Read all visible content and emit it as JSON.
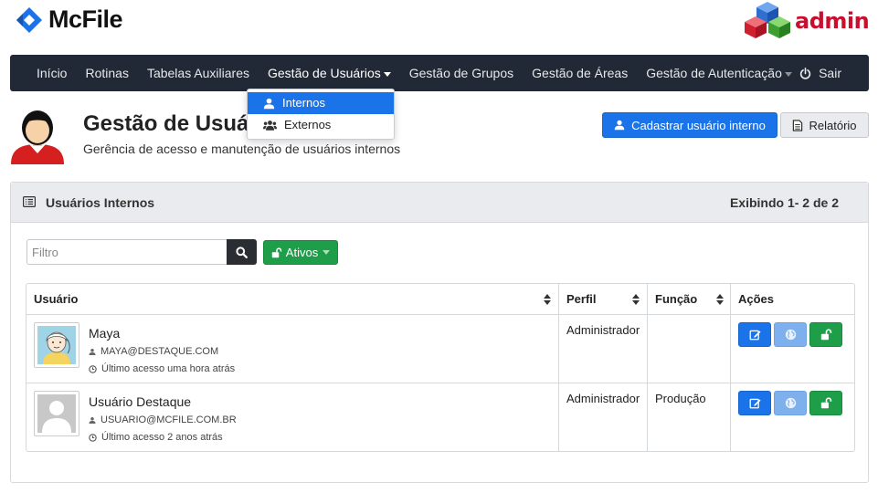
{
  "brand": {
    "name": "McFile",
    "admin_label": "admin"
  },
  "nav": {
    "items": [
      {
        "label": "Início"
      },
      {
        "label": "Rotinas"
      },
      {
        "label": "Tabelas Auxiliares"
      },
      {
        "label": "Gestão de Usuários"
      },
      {
        "label": "Gestão de Grupos"
      },
      {
        "label": "Gestão de Áreas"
      },
      {
        "label": "Gestão de Autenticação"
      }
    ],
    "logout": "Sair"
  },
  "dropdown": {
    "items": [
      {
        "label": "Internos"
      },
      {
        "label": "Externos"
      }
    ]
  },
  "page": {
    "title": "Gestão de Usuá",
    "subtitle": "Gerência de acesso e manutenção de usuários internos",
    "add_button": "Cadastrar usuário interno",
    "report_button": "Relatório"
  },
  "panel": {
    "title": "Usuários Internos",
    "count": "Exibindo 1- 2 de 2",
    "filter_placeholder": "Filtro",
    "status_label": "Ativos"
  },
  "table": {
    "columns": [
      "Usuário",
      "Perfil",
      "Função",
      "Ações"
    ],
    "rows": [
      {
        "name": "Maya",
        "email": "MAYA@DESTAQUE.COM",
        "last_access": "Último acesso uma hora atrás",
        "profile": "Administrador",
        "function": ""
      },
      {
        "name": "Usuário Destaque",
        "email": "USUARIO@MCFILE.COM.BR",
        "last_access": "Último acesso 2 anos atrás",
        "profile": "Administrador",
        "function": "Produção"
      }
    ]
  },
  "colors": {
    "navbar": "#212936",
    "primary": "#1a73e8",
    "success": "#1e9e48",
    "admin_red": "#c8102e"
  }
}
